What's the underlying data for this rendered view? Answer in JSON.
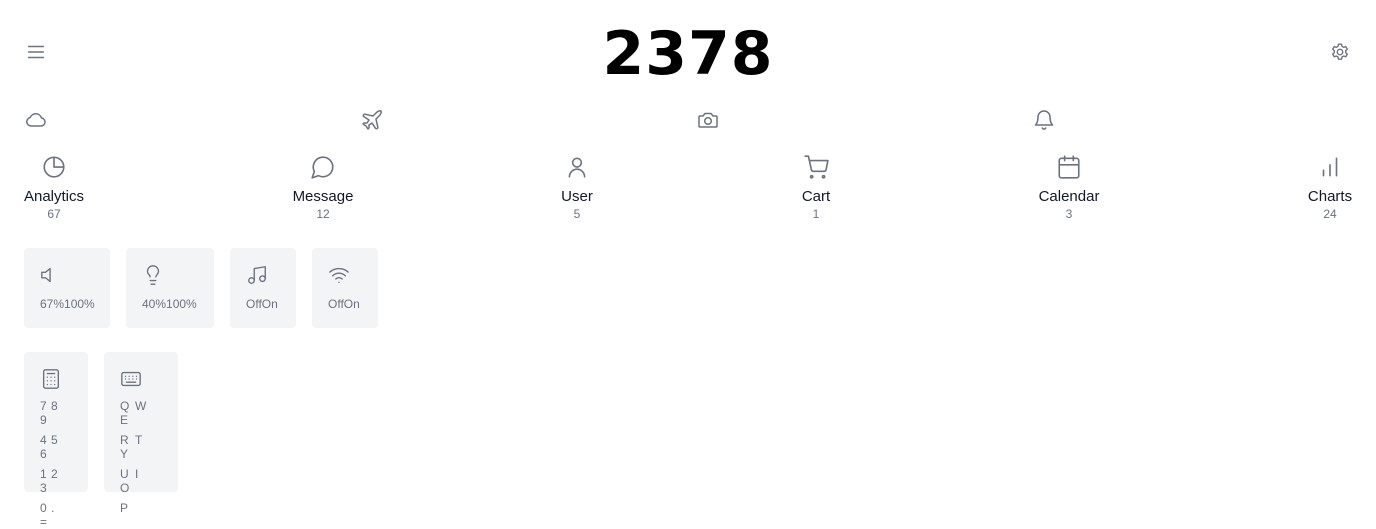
{
  "header": {
    "counter": "2378",
    "menu_icon": "menu-icon",
    "settings_icon": "gear-icon"
  },
  "quick_icons": [
    "cloud-icon",
    "plane-icon",
    "camera-icon",
    "bell-icon"
  ],
  "nav": [
    {
      "label": "Analytics",
      "count": "67",
      "icon": "pie-chart-icon"
    },
    {
      "label": "Message",
      "count": "12",
      "icon": "message-circle-icon"
    },
    {
      "label": "User",
      "count": "5",
      "icon": "user-icon"
    },
    {
      "label": "Cart",
      "count": "1",
      "icon": "shopping-cart-icon"
    },
    {
      "label": "Calendar",
      "count": "3",
      "icon": "calendar-icon"
    },
    {
      "label": "Charts",
      "count": "24",
      "icon": "bar-chart-icon"
    }
  ],
  "tiles": {
    "volume": {
      "text": "67%100%",
      "icon": "volume-icon"
    },
    "brightness": {
      "text": "40%100%",
      "icon": "lightbulb-icon"
    },
    "music": {
      "text": "OffOn",
      "icon": "music-icon"
    },
    "wifi": {
      "text": "OffOn",
      "icon": "wifi-icon"
    }
  },
  "calculator": {
    "icon": "calculator-icon",
    "rows": [
      [
        "7",
        "8",
        "9"
      ],
      [
        "4",
        "5",
        "6"
      ],
      [
        "1",
        "2",
        "3"
      ],
      [
        "0",
        ".",
        "="
      ]
    ]
  },
  "keyboard": {
    "icon": "keyboard-icon",
    "rows": [
      [
        "Q",
        "W",
        "E"
      ],
      [
        "R",
        "T",
        "Y"
      ],
      [
        "U",
        "I",
        "O"
      ],
      [
        "P"
      ]
    ]
  },
  "colors": {
    "icon": "#6b7280",
    "tile_bg": "#f3f4f6",
    "text": "#111827",
    "counter": "#000000"
  }
}
